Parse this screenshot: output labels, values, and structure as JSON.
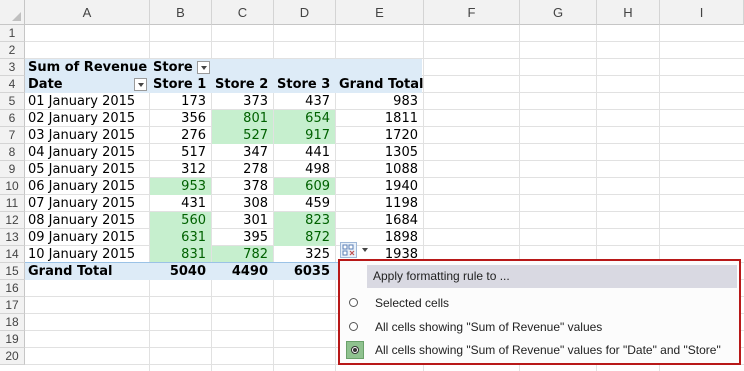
{
  "columns": [
    "A",
    "B",
    "C",
    "D",
    "E",
    "F",
    "G",
    "H",
    "I"
  ],
  "rows": [
    "1",
    "2",
    "3",
    "4",
    "5",
    "6",
    "7",
    "8",
    "9",
    "10",
    "11",
    "12",
    "13",
    "14",
    "15",
    "16",
    "17",
    "18",
    "19",
    "20"
  ],
  "pivot": {
    "value_field_label": "Sum of Revenue",
    "column_field_label": "Store",
    "row_field_label": "Date",
    "stores": [
      "Store 1",
      "Store 2",
      "Store 3"
    ],
    "grand_total_label": "Grand Total",
    "data": [
      {
        "date": "01 January 2015",
        "s1": "173",
        "s2": "373",
        "s3": "437",
        "total": "983",
        "hl": [
          false,
          false,
          false
        ]
      },
      {
        "date": "02 January 2015",
        "s1": "356",
        "s2": "801",
        "s3": "654",
        "total": "1811",
        "hl": [
          false,
          true,
          true
        ]
      },
      {
        "date": "03 January 2015",
        "s1": "276",
        "s2": "527",
        "s3": "917",
        "total": "1720",
        "hl": [
          false,
          true,
          true
        ]
      },
      {
        "date": "04 January 2015",
        "s1": "517",
        "s2": "347",
        "s3": "441",
        "total": "1305",
        "hl": [
          false,
          false,
          false
        ]
      },
      {
        "date": "05 January 2015",
        "s1": "312",
        "s2": "278",
        "s3": "498",
        "total": "1088",
        "hl": [
          false,
          false,
          false
        ]
      },
      {
        "date": "06 January 2015",
        "s1": "953",
        "s2": "378",
        "s3": "609",
        "total": "1940",
        "hl": [
          true,
          false,
          true
        ]
      },
      {
        "date": "07 January 2015",
        "s1": "431",
        "s2": "308",
        "s3": "459",
        "total": "1198",
        "hl": [
          false,
          false,
          false
        ]
      },
      {
        "date": "08 January 2015",
        "s1": "560",
        "s2": "301",
        "s3": "823",
        "total": "1684",
        "hl": [
          true,
          false,
          true
        ]
      },
      {
        "date": "09 January 2015",
        "s1": "631",
        "s2": "395",
        "s3": "872",
        "total": "1898",
        "hl": [
          true,
          false,
          true
        ]
      },
      {
        "date": "10 January 2015",
        "s1": "831",
        "s2": "782",
        "s3": "325",
        "total": "1938",
        "hl": [
          true,
          true,
          false
        ]
      }
    ],
    "grand_totals": {
      "s1": "5040",
      "s2": "4490",
      "s3": "6035"
    }
  },
  "formatting_menu": {
    "title": "Apply formatting rule to ...",
    "options": [
      {
        "label": "Selected cells",
        "selected": false
      },
      {
        "label": "All cells showing \"Sum of Revenue\" values",
        "selected": false
      },
      {
        "label": "All cells showing \"Sum of Revenue\" values for \"Date\" and \"Store\"",
        "selected": true
      }
    ]
  },
  "colors": {
    "highlight_fill": "#c6efce",
    "highlight_text": "#006100",
    "pivot_header": "#ddebf7",
    "menu_border": "#b81818"
  }
}
